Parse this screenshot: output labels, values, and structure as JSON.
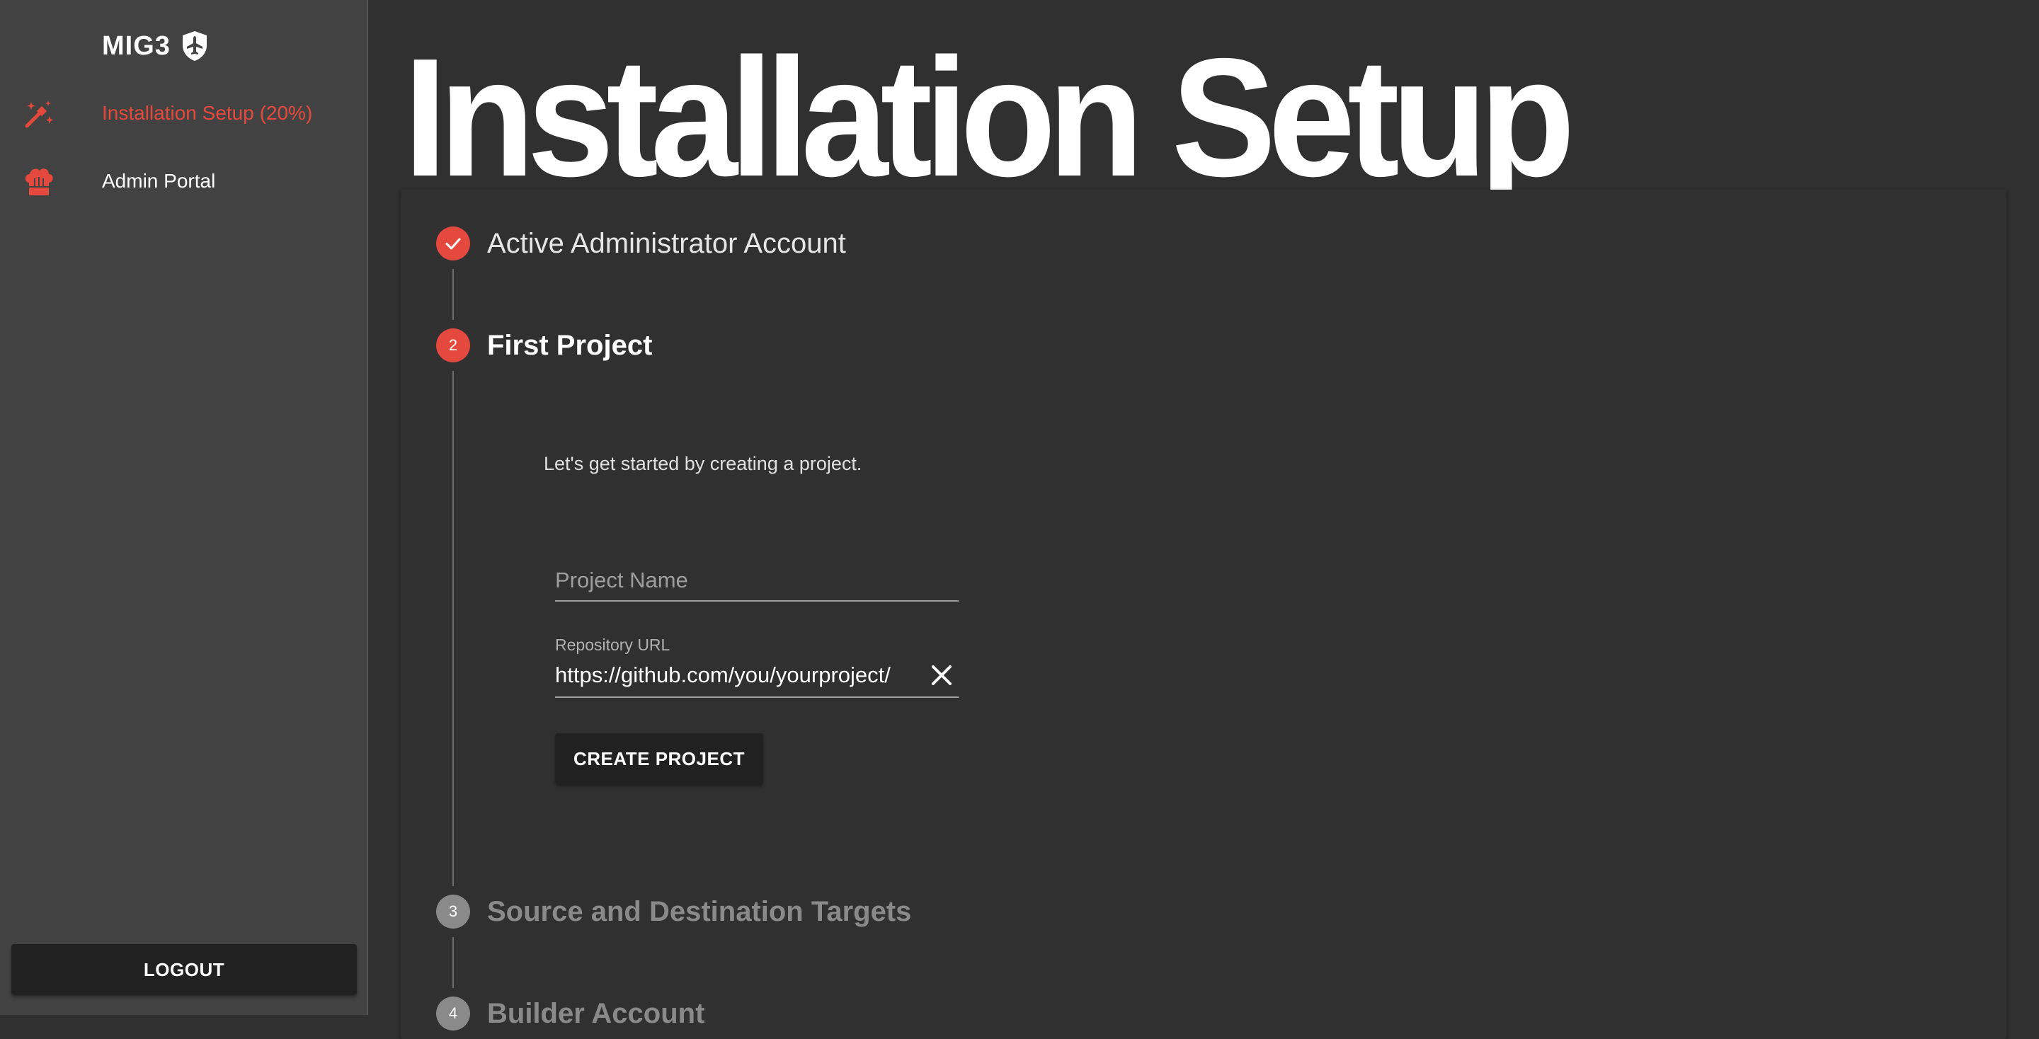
{
  "colors": {
    "accent": "#e5493e",
    "sidebar_bg": "#424242",
    "main_bg": "#303030",
    "button_bg": "#212121",
    "pending": "#8a8a8a"
  },
  "sidebar": {
    "brand": {
      "name": "MIG3",
      "icon": "shield-plane-icon"
    },
    "items": [
      {
        "label": "Installation Setup (20%)",
        "icon": "magic-wand-icon",
        "active": true
      },
      {
        "label": "Admin Portal",
        "icon": "chef-hat-icon",
        "active": false
      }
    ],
    "logout_label": "LOGOUT"
  },
  "main": {
    "title": "Installation Setup",
    "steps": [
      {
        "number": "1",
        "title": "Active Administrator Account",
        "state": "done",
        "icon": "check-icon"
      },
      {
        "number": "2",
        "title": "First Project",
        "state": "active"
      },
      {
        "number": "3",
        "title": "Source and Destination Targets",
        "state": "pending"
      },
      {
        "number": "4",
        "title": "Builder Account",
        "state": "pending"
      }
    ],
    "first_project": {
      "description": "Let's get started by creating a project.",
      "project_name": {
        "placeholder": "Project Name",
        "value": ""
      },
      "repository_url": {
        "label": "Repository URL",
        "value": "https://github.com/you/yourproject/",
        "clear_icon": "close-icon"
      },
      "create_label": "CREATE PROJECT"
    }
  }
}
